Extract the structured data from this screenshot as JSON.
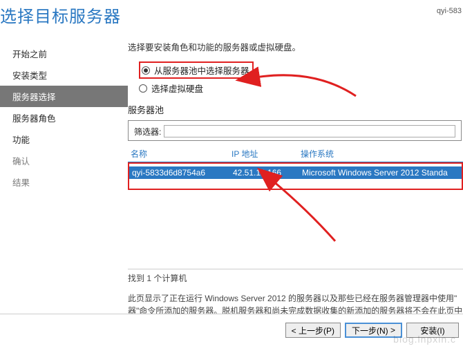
{
  "header": {
    "title": "选择目标服务器",
    "server": "qyi-583"
  },
  "sidebar": {
    "items": [
      {
        "label": "开始之前",
        "state": "clickable"
      },
      {
        "label": "安装类型",
        "state": "clickable"
      },
      {
        "label": "服务器选择",
        "state": "active"
      },
      {
        "label": "服务器角色",
        "state": "clickable"
      },
      {
        "label": "功能",
        "state": "clickable"
      },
      {
        "label": "确认",
        "state": "disabled"
      },
      {
        "label": "结果",
        "state": "disabled"
      }
    ]
  },
  "main": {
    "instruction": "选择要安装角色和功能的服务器或虚拟硬盘。",
    "radios": {
      "pool": "从服务器池中选择服务器",
      "vhd": "选择虚拟硬盘"
    },
    "poolTitle": "服务器池",
    "filterLabel": "筛选器:",
    "filterValue": "",
    "columns": {
      "name": "名称",
      "ip": "IP 地址",
      "os": "操作系统"
    },
    "rows": [
      {
        "name": "qyi-5833d6d8754a6",
        "ip": "42.51.12.166",
        "os": "Microsoft Windows Server 2012 Standa"
      }
    ],
    "found": "找到 1 个计算机",
    "desc1": "此页显示了正在运行 Windows Server 2012 的服务器以及那些已经在服务器管理器中使用\"",
    "desc2": "器\"命令所添加的服务器。脱机服务器和尚未完成数据收集的新添加的服务器将不会在此页中"
  },
  "footer": {
    "prev": "< 上一步(P)",
    "next": "下一步(N)",
    "install": "安装(I)"
  },
  "watermark": "blog.lnpxin.c"
}
